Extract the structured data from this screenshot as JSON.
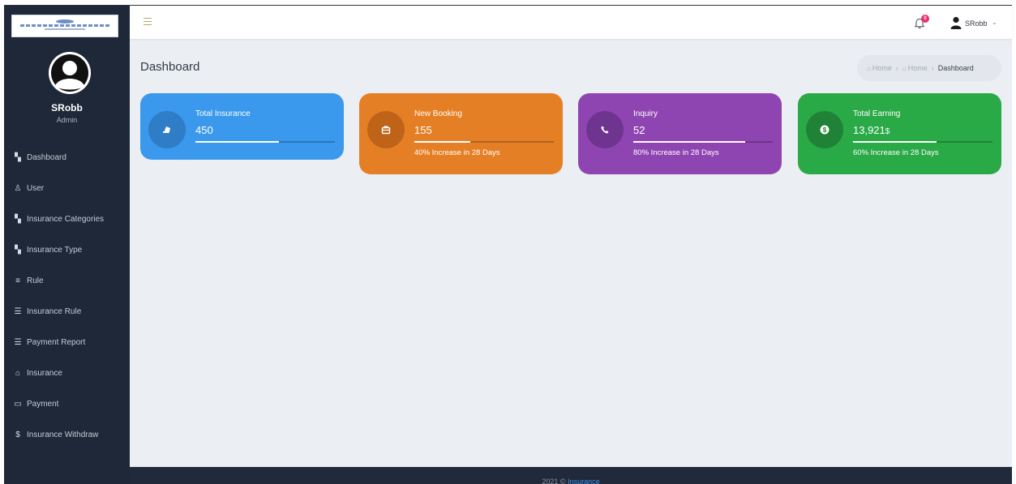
{
  "user": {
    "name": "SRobb",
    "role": "Admin"
  },
  "sidebar": {
    "items": [
      {
        "label": "Dashboard",
        "icon": "dashboard-icon",
        "glyph": "▚"
      },
      {
        "label": "User",
        "icon": "user-icon",
        "glyph": "♙"
      },
      {
        "label": "Insurance Categories",
        "icon": "grid-icon",
        "glyph": "▚"
      },
      {
        "label": "Insurance Type",
        "icon": "grid-icon",
        "glyph": "▚"
      },
      {
        "label": "Rule",
        "icon": "list-icon",
        "glyph": "≡"
      },
      {
        "label": "Insurance Rule",
        "icon": "filter-icon",
        "glyph": "☰"
      },
      {
        "label": "Payment Report",
        "icon": "filter-icon",
        "glyph": "☰"
      },
      {
        "label": "Insurance",
        "icon": "bank-icon",
        "glyph": "⌂"
      },
      {
        "label": "Payment",
        "icon": "credit-card-icon",
        "glyph": "▭"
      },
      {
        "label": "Insurance Withdraw",
        "icon": "dollar-icon",
        "glyph": "$"
      }
    ]
  },
  "header": {
    "notification_count": "0",
    "user_name": "SRobb",
    "caret": "⌄"
  },
  "page": {
    "title": "Dashboard",
    "breadcrumb": {
      "home1": "Home",
      "home2": "Home",
      "current": "Dashboard",
      "sep": "›",
      "home_glyph": "⌂"
    }
  },
  "cards": [
    {
      "label": "Total Insurance",
      "value": "450",
      "unit": "",
      "desc": "",
      "progress": 0.6,
      "bg": "#3a99ed",
      "icon_bg": "#2f7cc7",
      "icon": "ticket-icon"
    },
    {
      "label": "New Booking",
      "value": "155",
      "unit": "",
      "desc": "40% Increase in 28 Days",
      "progress": 0.4,
      "bg": "#e57f25",
      "icon_bg": "#bf6318",
      "icon": "briefcase-icon"
    },
    {
      "label": "Inquiry",
      "value": "52",
      "unit": "",
      "desc": "80% Increase in 28 Days",
      "progress": 0.8,
      "bg": "#8f45b1",
      "icon_bg": "#6e3490",
      "icon": "phone-icon"
    },
    {
      "label": "Total Earning",
      "value": "13,921",
      "unit": "$",
      "desc": "60% Increase in 28 Days",
      "progress": 0.6,
      "bg": "#2aa947",
      "icon_bg": "#1f8237",
      "icon": "dollar-circle-icon"
    }
  ],
  "footer": {
    "text": "2021 ©",
    "brand": "Insurance"
  }
}
